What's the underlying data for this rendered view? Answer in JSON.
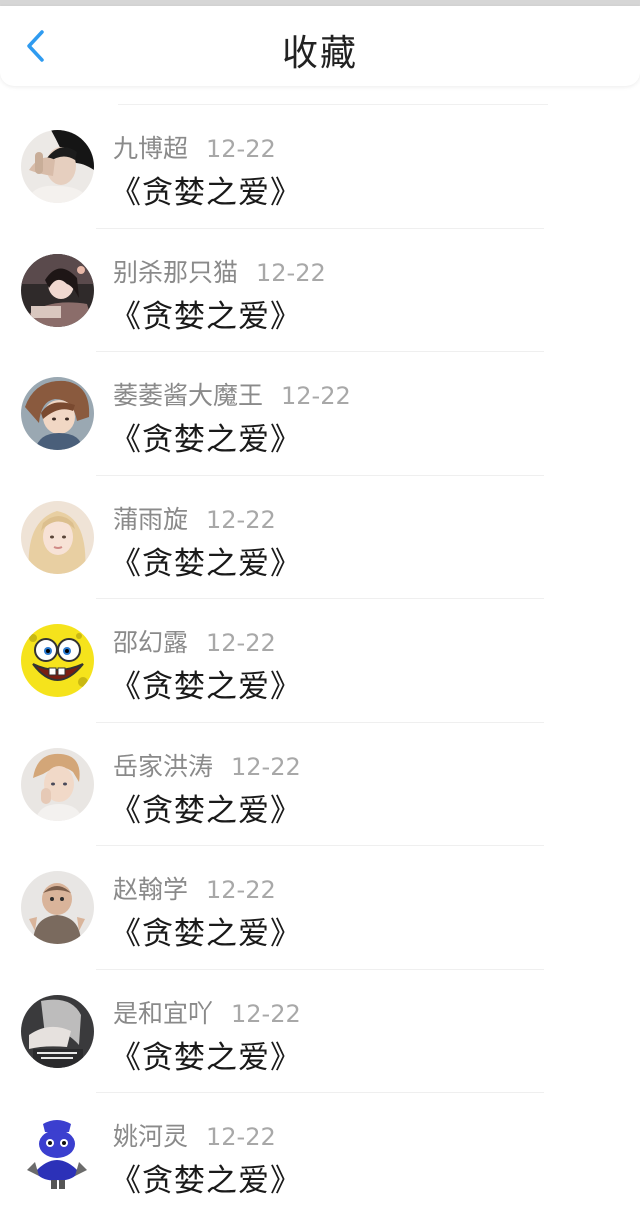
{
  "header": {
    "title": "收藏",
    "back_icon": "chevron-left-icon",
    "accent_color": "#2f9bf0"
  },
  "items": [
    {
      "name": "九博超",
      "date": "12-22",
      "work": "《贪婪之爱》",
      "avatar_icon": "avatar-photo-person-hand"
    },
    {
      "name": "别杀那只猫",
      "date": "12-22",
      "work": "《贪婪之爱》",
      "avatar_icon": "avatar-photo-girl"
    },
    {
      "name": "萎萎酱大魔王",
      "date": "12-22",
      "work": "《贪婪之爱》",
      "avatar_icon": "avatar-anime-girl"
    },
    {
      "name": "蒲雨旋",
      "date": "12-22",
      "work": "《贪婪之爱》",
      "avatar_icon": "avatar-photo-blonde-girl"
    },
    {
      "name": "邵幻露",
      "date": "12-22",
      "work": "《贪婪之爱》",
      "avatar_icon": "avatar-spongebob-face"
    },
    {
      "name": "岳家洪涛",
      "date": "12-22",
      "work": "《贪婪之爱》",
      "avatar_icon": "avatar-photo-child"
    },
    {
      "name": "赵翰学",
      "date": "12-22",
      "work": "《贪婪之爱》",
      "avatar_icon": "avatar-photo-baby"
    },
    {
      "name": "是和宜吖",
      "date": "12-22",
      "work": "《贪婪之爱》",
      "avatar_icon": "avatar-photo-hand-text"
    },
    {
      "name": "姚河灵",
      "date": "12-22",
      "work": "《贪婪之爱》",
      "avatar_icon": "avatar-blue-cartoon"
    }
  ]
}
